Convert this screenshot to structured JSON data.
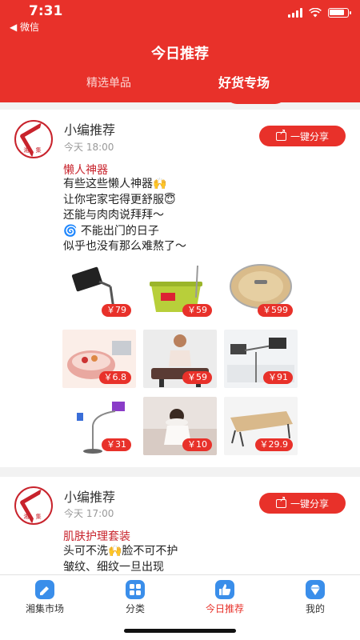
{
  "status_bar": {
    "time": "7:31",
    "back_app": "◀ 微信"
  },
  "header": {
    "title": "今日推荐",
    "tabs": [
      {
        "label": "精选单品",
        "active": false
      },
      {
        "label": "好货专场",
        "active": true
      }
    ]
  },
  "posts": [
    {
      "author": "小编推荐",
      "time": "今天 18:00",
      "share_label": "一键分享",
      "title": "懒人神器",
      "lines": [
        "有些这些懒人神器🙌",
        "让你宅家宅得更舒服😇",
        "还能与肉肉说拜拜～",
        "🌀 不能出门的日子",
        "似乎也没有那么难熬了～"
      ],
      "products": [
        {
          "price": "￥79",
          "product": "平板支架"
        },
        {
          "price": "￥59",
          "product": "拖把桶"
        },
        {
          "price": "￥599",
          "product": "扫地机器人"
        },
        {
          "price": "￥6.8",
          "product": "沥水篮"
        },
        {
          "price": "￥59",
          "product": "健身器"
        },
        {
          "price": "￥91",
          "product": "床头支架"
        },
        {
          "price": "￥31",
          "product": "落地支架"
        },
        {
          "price": "￥10",
          "product": "颈枕"
        },
        {
          "price": "￥29.9",
          "product": "床上桌"
        }
      ]
    },
    {
      "author": "小编推荐",
      "time": "今天 17:00",
      "share_label": "一键分享",
      "title": "肌肤护理套装",
      "lines": [
        "头可不洗🙌脸不可不护",
        "皱纹、细纹一旦出现"
      ]
    }
  ],
  "avatar_text": "湘 集",
  "tabbar": [
    {
      "label": "湘集市场",
      "icon": "market-icon",
      "active": false
    },
    {
      "label": "分类",
      "icon": "category-icon",
      "active": false
    },
    {
      "label": "今日推荐",
      "icon": "thumbs-up-icon",
      "active": true
    },
    {
      "label": "我的",
      "icon": "diamond-icon",
      "active": false
    }
  ],
  "colors": {
    "brand_red": "#e8312a",
    "title_red": "#c8232c",
    "tab_blue": "#3a8eea"
  }
}
